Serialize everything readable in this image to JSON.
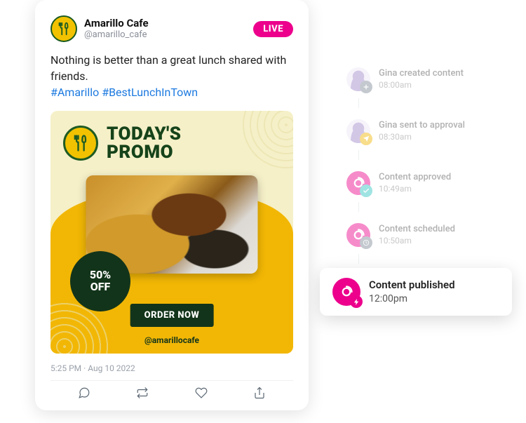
{
  "tweet": {
    "account_name": "Amarillo Cafe",
    "account_handle": "@amarillo_cafe",
    "live_badge": "LIVE",
    "body_plain": "Nothing is better than a great lunch shared with friends.",
    "hashtags": "#Amarillo #BestLunchInTown",
    "timestamp": "5:25 PM · Aug 10 2022"
  },
  "promo": {
    "title_line1": "TODAY'S",
    "title_line2": "PROMO",
    "badge_line1": "50%",
    "badge_line2": "OFF",
    "cta": "ORDER NOW",
    "handle": "@amarillocafe"
  },
  "timeline": [
    {
      "icon": "avatar",
      "sub": "plus",
      "sub_color": "#7d8a97",
      "title": "Gina created content",
      "time": "08:00am",
      "active": false
    },
    {
      "icon": "avatar",
      "sub": "send",
      "sub_color": "#f0b400",
      "title": "Gina sent to approval",
      "time": "08:30am",
      "active": false
    },
    {
      "icon": "brand",
      "sub": "check",
      "sub_color": "#2dc5c0",
      "title": "Content approved",
      "time": "10:49am",
      "active": false
    },
    {
      "icon": "brand",
      "sub": "clock",
      "sub_color": "#7d8a97",
      "title": "Content scheduled",
      "time": "10:50am",
      "active": false
    },
    {
      "icon": "brand",
      "sub": "bolt",
      "sub_color": "#ec008c",
      "title": "Content published",
      "time": "12:00pm",
      "active": true
    }
  ]
}
